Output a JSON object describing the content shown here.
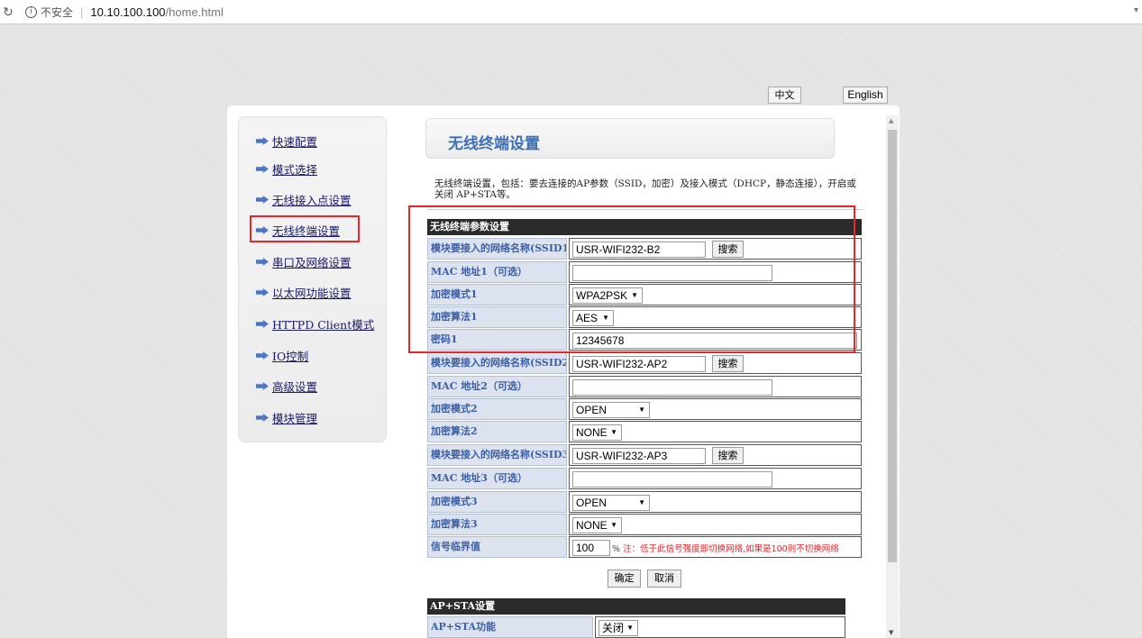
{
  "browser": {
    "security_label": "不安全",
    "url_host": "10.10.100.100",
    "url_path": "/home.html"
  },
  "lang": {
    "zh": "中文",
    "en": "English"
  },
  "sidebar": {
    "items": [
      {
        "label": "快速配置"
      },
      {
        "label": "模式选择"
      },
      {
        "label": "无线接入点设置"
      },
      {
        "label": "无线终端设置",
        "active": true
      },
      {
        "label": "串口及网络设置"
      },
      {
        "label": "以太网功能设置"
      },
      {
        "label": "HTTPD Client模式"
      },
      {
        "label": "IO控制"
      },
      {
        "label": "高级设置"
      },
      {
        "label": "模块管理"
      }
    ]
  },
  "page": {
    "title": "无线终端设置",
    "description": "无线终端设置，包括：要去连接的AP参数（SSID，加密）及接入模式（DHCP，静态连接），开启或关闭 AP+STA等。"
  },
  "sta_section": {
    "header": "无线终端参数设置",
    "rows": [
      {
        "label": "模块要接入的网络名称(SSID1)",
        "value": "USR-WIFI232-B2",
        "button": "搜索"
      },
      {
        "label": "MAC 地址1（可选）",
        "value": ""
      },
      {
        "label": "加密模式1",
        "value": "WPA2PSK"
      },
      {
        "label": "加密算法1",
        "value": "AES"
      },
      {
        "label": "密码1",
        "value": "12345678"
      },
      {
        "label": "模块要接入的网络名称(SSID2)",
        "value": "USR-WIFI232-AP2",
        "button": "搜索"
      },
      {
        "label": "MAC 地址2（可选）",
        "value": ""
      },
      {
        "label": "加密模式2",
        "value": "OPEN"
      },
      {
        "label": "加密算法2",
        "value": "NONE"
      },
      {
        "label": "模块要接入的网络名称(SSID3)",
        "value": "USR-WIFI232-AP3",
        "button": "搜索"
      },
      {
        "label": "MAC 地址3（可选）",
        "value": ""
      },
      {
        "label": "加密模式3",
        "value": "OPEN"
      },
      {
        "label": "加密算法3",
        "value": "NONE"
      },
      {
        "label": "信号临界值",
        "value": "100",
        "unit": "%",
        "note": "注：低于此信号强度即切换网络,如果是100则不切换网络"
      }
    ]
  },
  "actions": {
    "ok": "确定",
    "cancel": "取消"
  },
  "apsta_section": {
    "header": "AP+STA设置",
    "rows": [
      {
        "label": "AP+STA功能",
        "value": "关闭"
      }
    ]
  },
  "colors": {
    "accent": "#3d6fb6",
    "highlight": "#e8262a",
    "label_bg": "#dde3ee"
  }
}
